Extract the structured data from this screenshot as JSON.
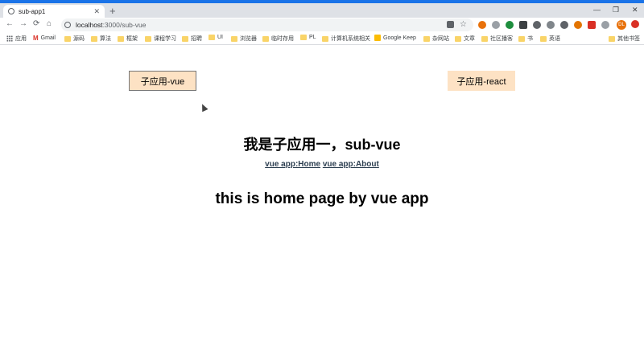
{
  "browser": {
    "tab": {
      "title": "sub-app1",
      "close": "✕"
    },
    "new_tab": "+",
    "window": {
      "minimize": "—",
      "maximize": "❐",
      "close": "✕"
    },
    "nav": {
      "back": "←",
      "forward": "→",
      "reload": "⟳",
      "home": "⌂"
    },
    "address": {
      "host": "localhost",
      "path": ":3000/sub-vue",
      "star": "☆"
    },
    "profile_initials": "DL",
    "bookmarks": [
      "应用",
      "Gmail",
      "源码",
      "算法",
      "框架",
      "课程学习",
      "招聘",
      "UI",
      "浏览器",
      "临时存用",
      "PL",
      "计算机系统相关",
      "Google Keep",
      "杂网站",
      "文章",
      "社区播客",
      "书",
      "英语",
      "其他书签"
    ]
  },
  "app": {
    "buttons": {
      "vue": "子应用-vue",
      "react": "子应用-react"
    },
    "heading": "我是子应用一，sub-vue",
    "links": {
      "home": "vue app:Home",
      "about": "vue app:About"
    },
    "page_heading": "this is home page by vue app"
  },
  "colors": {
    "button_bg": "#fde2c4",
    "chrome_accent": "#1a73e8",
    "link": "#2c3e50"
  }
}
